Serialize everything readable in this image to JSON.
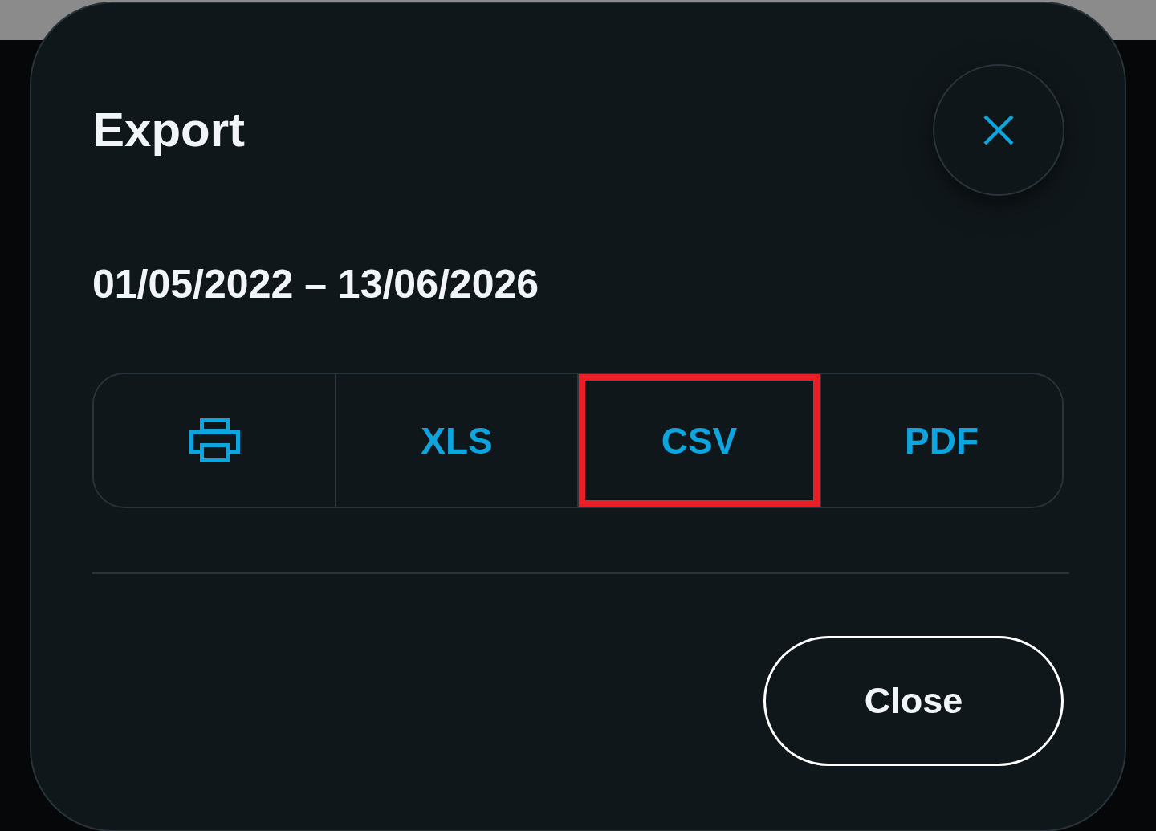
{
  "dialog": {
    "title": "Export",
    "date_range": "01/05/2022 – 13/06/2026",
    "export_options": [
      {
        "kind": "icon",
        "highlighted": false
      },
      {
        "kind": "text",
        "label": "XLS",
        "highlighted": false
      },
      {
        "kind": "text",
        "label": "CSV",
        "highlighted": true
      },
      {
        "kind": "text",
        "label": "PDF",
        "highlighted": false
      }
    ],
    "footer_buttons": [
      {
        "label": "Close"
      }
    ]
  }
}
